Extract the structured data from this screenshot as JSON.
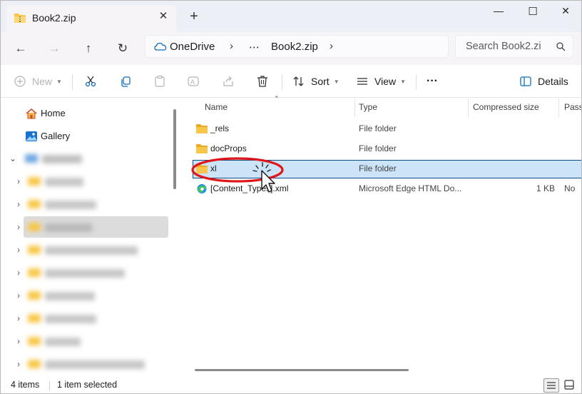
{
  "window": {
    "tab_title": "Book2.zip",
    "close_tab_glyph": "✕",
    "new_tab_glyph": "+",
    "minimize_glyph": "—",
    "maximize_glyph": "☐",
    "close_glyph": "✕"
  },
  "nav": {
    "back_glyph": "←",
    "forward_glyph": "→",
    "up_glyph": "↑",
    "refresh_glyph": "↻"
  },
  "address": {
    "segments": [
      "OneDrive",
      "⋯",
      "Book2.zip"
    ],
    "separator": "›"
  },
  "search": {
    "placeholder": "Search Book2.zi"
  },
  "toolbar": {
    "new_label": "New",
    "sort_label": "Sort",
    "view_label": "View",
    "more_glyph": "···",
    "details_label": "Details"
  },
  "sidebar": {
    "items": [
      {
        "label": "Home",
        "icon": "home-icon"
      },
      {
        "label": "Gallery",
        "icon": "gallery-icon"
      }
    ]
  },
  "file_list": {
    "columns": [
      "Name",
      "Type",
      "Compressed size",
      "Passw"
    ],
    "rows": [
      {
        "name": "_rels",
        "type": "File folder",
        "size": "",
        "password": "",
        "icon": "folder-icon",
        "selected": false
      },
      {
        "name": "docProps",
        "type": "File folder",
        "size": "",
        "password": "",
        "icon": "folder-icon",
        "selected": false
      },
      {
        "name": "xl",
        "type": "File folder",
        "size": "",
        "password": "",
        "icon": "folder-icon",
        "selected": true
      },
      {
        "name": "[Content_Types].xml",
        "type": "Microsoft Edge HTML Do...",
        "size": "1 KB",
        "password": "No",
        "icon": "edge-icon",
        "selected": false
      }
    ]
  },
  "status": {
    "items_count": "4 items",
    "selection": "1 item selected"
  },
  "colors": {
    "accent": "#0f6cbd",
    "selection_bg": "#cce4f7",
    "selection_border": "#0f4a85",
    "folder": "#f8c74a",
    "annotation": "#e0161b"
  }
}
